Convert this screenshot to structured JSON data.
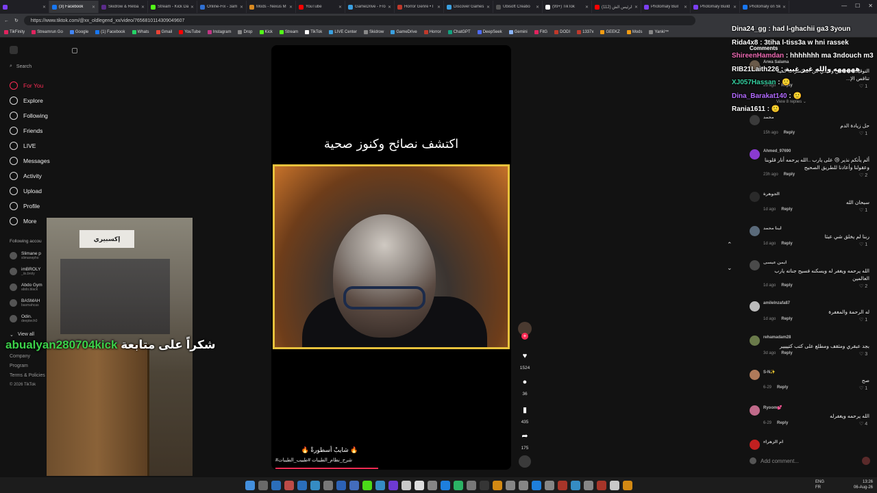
{
  "tabs": [
    {
      "label": "",
      "color": "#7b3ff2"
    },
    {
      "label": "(3) Facebook",
      "color": "#1877f2",
      "active": true
    },
    {
      "label": "Skidrow & Reloa",
      "color": "#5b2b8a"
    },
    {
      "label": "Stream - Kick Da",
      "color": "#53fc18"
    },
    {
      "label": "Online-Fix - 3am",
      "color": "#2f6fd1"
    },
    {
      "label": "Mods - Nexus M",
      "color": "#d98a20"
    },
    {
      "label": "YouTube",
      "color": "#ff0000"
    },
    {
      "label": "GameDrive - Fro",
      "color": "#3aa0e0"
    },
    {
      "label": "Horror Genre • I",
      "color": "#c0392b"
    },
    {
      "label": "Discover Games",
      "color": "#3aa0e0"
    },
    {
      "label": "Ubisoft Creatio",
      "color": "#555"
    },
    {
      "label": "(99+) TikTok",
      "color": "#fff"
    },
    {
      "label": "(112) الرئيس الش",
      "color": "#ff0000"
    },
    {
      "label": "Photomaly Buil",
      "color": "#7b3ff2"
    },
    {
      "label": "Photomaly Build",
      "color": "#7b3ff2"
    },
    {
      "label": "Photomaly on Sk",
      "color": "#1877f2"
    }
  ],
  "address": {
    "url": "https://www.tiktok.com/@xx_oldlegend_xx/video/7656810114309049607"
  },
  "bookmarks": [
    {
      "label": "TikFinity",
      "color": "#e0245e"
    },
    {
      "label": "Streamrun Go",
      "color": "#e0245e"
    },
    {
      "label": "Google",
      "color": "#4285f4"
    },
    {
      "label": "(1) Facebook",
      "color": "#1877f2"
    },
    {
      "label": "Whats",
      "color": "#25d366"
    },
    {
      "label": "Gmail",
      "color": "#ea4335"
    },
    {
      "label": "YouTube",
      "color": "#ff0000"
    },
    {
      "label": "Instagram",
      "color": "#c13584"
    },
    {
      "label": "Drop",
      "color": "#888"
    },
    {
      "label": "Kick",
      "color": "#53fc18"
    },
    {
      "label": "Stream",
      "color": "#53fc18"
    },
    {
      "label": "TikTok",
      "color": "#fff"
    },
    {
      "label": "LIVE Center",
      "color": "#3aa0e0"
    },
    {
      "label": "Skidrow",
      "color": "#888"
    },
    {
      "label": "GameDrive",
      "color": "#3aa0e0"
    },
    {
      "label": "Horror",
      "color": "#c0392b"
    },
    {
      "label": "ChatGPT",
      "color": "#10a37f"
    },
    {
      "label": "DeepSeek",
      "color": "#4d6bfe"
    },
    {
      "label": "Gemini",
      "color": "#8ab4f8"
    },
    {
      "label": "FitG",
      "color": "#e0245e"
    },
    {
      "label": "DODI",
      "color": "#c0392b"
    },
    {
      "label": "1337x",
      "color": "#c0392b"
    },
    {
      "label": "GEEKZ",
      "color": "#f39c12"
    },
    {
      "label": "Mods",
      "color": "#f39c12"
    },
    {
      "label": "Yanki™",
      "color": "#888"
    }
  ],
  "sidebar": {
    "search": "Search",
    "nav": [
      {
        "label": "For You",
        "active": true
      },
      {
        "label": "Explore"
      },
      {
        "label": "Following"
      },
      {
        "label": "Friends"
      },
      {
        "label": "LIVE"
      },
      {
        "label": "Messages"
      },
      {
        "label": "Activity"
      },
      {
        "label": "Upload"
      },
      {
        "label": "Profile"
      },
      {
        "label": "More"
      }
    ],
    "following_header": "Following accou",
    "accounts": [
      {
        "name": "Slimane p",
        "handle": "slimanepho"
      },
      {
        "name": "imBROLY",
        "handle": "_iis.broly"
      },
      {
        "name": "Abdo Gym",
        "handle": "abdo.black"
      },
      {
        "name": "BASMAH",
        "handle": "basmahcas"
      },
      {
        "name": "Odin.",
        "handle": "deeptech0"
      }
    ],
    "view_all": "View all",
    "footer": [
      "Company",
      "Program",
      "Terms & Policies",
      "© 2026 TikTok"
    ]
  },
  "overlay": {
    "username": "abualyan280704kick",
    "thanks": "شكراً على متابعة",
    "sign_text": "إكسبيري"
  },
  "video": {
    "title": "اكتشف نصائح وكنوز صحية",
    "caption": "🔥 شايبْ أسطورةْ 🔥",
    "hashtags": "#شرح_نظام_الطيبات #طبيب_الطيبات"
  },
  "actions": {
    "likes": "1524",
    "comments": "36",
    "saves": "435",
    "shares": "175"
  },
  "chat": [
    {
      "user": "Dina24_gg",
      "msg": "had l-ghachii ga3 3youn",
      "color": "#ffffff"
    },
    {
      "user": "Rida4x8",
      "msg": "3tiha l-tiss3a w hni rassek",
      "color": "#ffffff"
    },
    {
      "user": "ShireenHamdan",
      "msg": "hhhhhhh ma 3ndouch m3",
      "color": "#f06bb4"
    },
    {
      "user": "RIB21Laith226",
      "msg": "هههههه والله غير غبية",
      "color": "#ffffff"
    },
    {
      "user": "XJ057Hassan",
      "msg": "🙂",
      "color": "#35d0a0"
    },
    {
      "user": "Dina_Barakat140",
      "msg": "🙂",
      "color": "#b36bff"
    },
    {
      "user": "Rania1611",
      "msg": "🙂",
      "color": "#ffffff"
    }
  ],
  "comments_panel": {
    "title": "Comments",
    "input_placeholder": "Add comment...",
    "reply_label": "Reply",
    "view_replies": "View 8 replies",
    "items": [
      {
        "name": "Arwa Salama",
        "text": "التوقيت فيه قلق والبدي من المكسرات كمية تناقص الإ...",
        "time": "2d ago",
        "likes": "1"
      },
      {
        "name": "محمد",
        "text": "حل زيادة الدم",
        "time": "15h ago",
        "likes": "1"
      },
      {
        "name": "Ahmed_97690",
        "text": "ألم يأتكم نذير 😢 على يارب ..الله يرحمه أنار قلوبنا وعقولنا وأعادنا للطريق الصحيح",
        "time": "23h ago",
        "likes": "2"
      },
      {
        "name": "الجوهرة",
        "text": "سبحان الله",
        "time": "1d ago",
        "likes": "1"
      },
      {
        "name": "لينا محمد",
        "text": "ربنا لم يخلق شي عبثا",
        "time": "1d ago",
        "likes": "1"
      },
      {
        "name": "ايمن عيسى",
        "text": "الله يرحمه ويغفر له ويسكنه فسيح جناته يارب العالمين",
        "time": "1d ago",
        "likes": "2"
      },
      {
        "name": "amilelnzafa87",
        "text": "له الرحمة والمغفرة",
        "time": "1d ago",
        "likes": "1"
      },
      {
        "name": "rehamadam28",
        "text": "بجد عبقري ومثقف ومطلع على كتب كتيييير",
        "time": "3d ago",
        "likes": "3"
      },
      {
        "name": "S-N✨",
        "text": "صح",
        "time": "6-29",
        "likes": "1"
      },
      {
        "name": "Ryoom💕",
        "text": "الله يرحمه ويغفرله",
        "time": "6-29",
        "likes": "4"
      },
      {
        "name": "ام الزهراء",
        "text": "",
        "time": "",
        "likes": ""
      }
    ]
  },
  "taskbar": {
    "lang": "ENG",
    "lang2": "FR",
    "time": "13:26",
    "date": "06-Aug-26"
  }
}
